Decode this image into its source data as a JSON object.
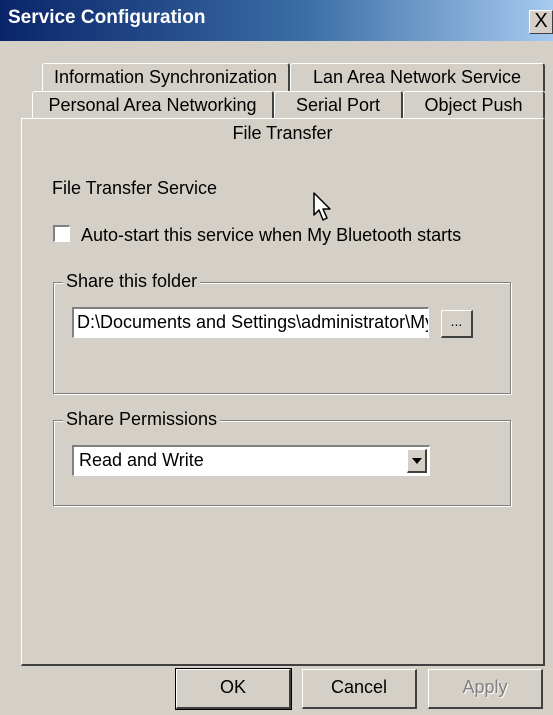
{
  "window": {
    "title": "Service Configuration",
    "close_glyph": "X"
  },
  "tabs": {
    "row_top": [
      "Information Synchronization",
      "Lan Area Network Service"
    ],
    "row_middle": [
      "Personal Area Networking",
      "Serial Port",
      "Object Push"
    ],
    "active": "File Transfer"
  },
  "panel": {
    "service_label": "File Transfer Service",
    "autostart": {
      "label": "Auto-start this service when My Bluetooth starts",
      "checked": false
    },
    "share_folder": {
      "group_title": "Share this folder",
      "path": "D:\\Documents and Settings\\administrator\\My",
      "browse_label": "..."
    },
    "permissions": {
      "group_title": "Share Permissions",
      "selected": "Read and Write"
    }
  },
  "buttons": {
    "ok": "OK",
    "cancel": "Cancel",
    "apply": "Apply"
  },
  "icons": {
    "cursor": "mouse-pointer-icon",
    "dropdown": "chevron-down-icon"
  }
}
